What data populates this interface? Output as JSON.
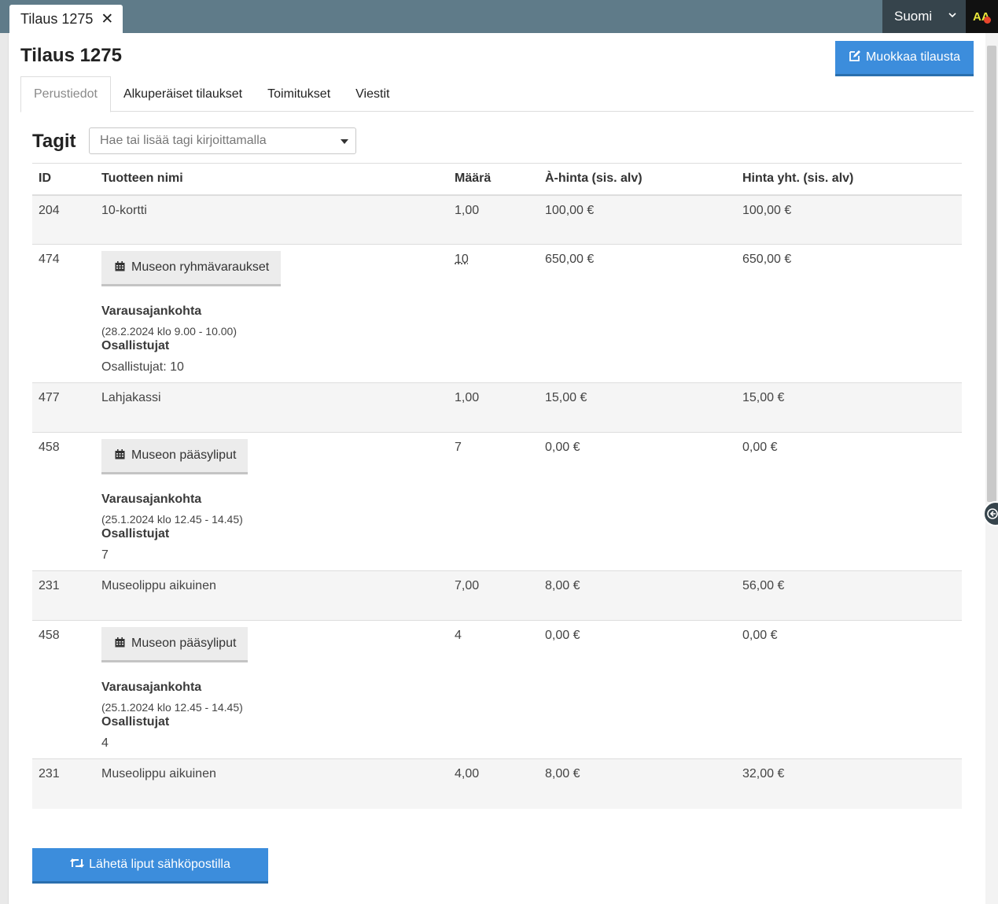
{
  "window": {
    "tab_title": "Tilaus 1275",
    "tab_close": "✕",
    "language": "Suomi",
    "accessibility_label": "AA"
  },
  "page": {
    "title": "Tilaus 1275",
    "edit_button": "Muokkaa tilausta"
  },
  "tabs": [
    {
      "label": "Perustiedot",
      "active": true
    },
    {
      "label": "Alkuperäiset tilaukset",
      "active": false
    },
    {
      "label": "Toimitukset",
      "active": false
    },
    {
      "label": "Viestit",
      "active": false
    }
  ],
  "tags": {
    "label": "Tagit",
    "placeholder": "Hae tai lisää tagi kirjoittamalla"
  },
  "table": {
    "headers": [
      "ID",
      "Tuotteen nimi",
      "Määrä",
      "À-hinta (sis. alv)",
      "Hinta yht. (sis. alv)"
    ],
    "rows": [
      {
        "id": "204",
        "name": "10-kortti",
        "qty": "1,00",
        "unit": "100,00 €",
        "total": "100,00 €"
      },
      {
        "id": "474",
        "name": "Museon ryhmävaraukset",
        "qty": "10",
        "unit": "650,00 €",
        "total": "650,00 €",
        "reservation_label": "Varausajankohta",
        "reservation_time": "(28.2.2024 klo 9.00 - 10.00)",
        "participants_label": "Osallistujat",
        "participants": "Osallistujat: 10"
      },
      {
        "id": "477",
        "name": "Lahjakassi",
        "qty": "1,00",
        "unit": "15,00 €",
        "total": "15,00 €"
      },
      {
        "id": "458",
        "name": "Museon pääsyliput",
        "qty": "7",
        "unit": "0,00 €",
        "total": "0,00 €",
        "reservation_label": "Varausajankohta",
        "reservation_time": "(25.1.2024 klo 12.45 - 14.45)",
        "participants_label": "Osallistujat",
        "participants": "7"
      },
      {
        "id": "231",
        "name": "Museolippu aikuinen",
        "qty": "7,00",
        "unit": "8,00 €",
        "total": "56,00 €"
      },
      {
        "id": "458",
        "name": "Museon pääsyliput",
        "qty": "4",
        "unit": "0,00 €",
        "total": "0,00 €",
        "reservation_label": "Varausajankohta",
        "reservation_time": "(25.1.2024 klo 12.45 - 14.45)",
        "participants_label": "Osallistujat",
        "participants": "4"
      },
      {
        "id": "231",
        "name": "Museolippu aikuinen",
        "qty": "4,00",
        "unit": "8,00 €",
        "total": "32,00 €"
      }
    ]
  },
  "send_button": "Lähetä liput sähköpostilla",
  "colors": {
    "topbar": "#5f7b89",
    "primary": "#3c8ddc",
    "language_bg": "#36444c"
  }
}
